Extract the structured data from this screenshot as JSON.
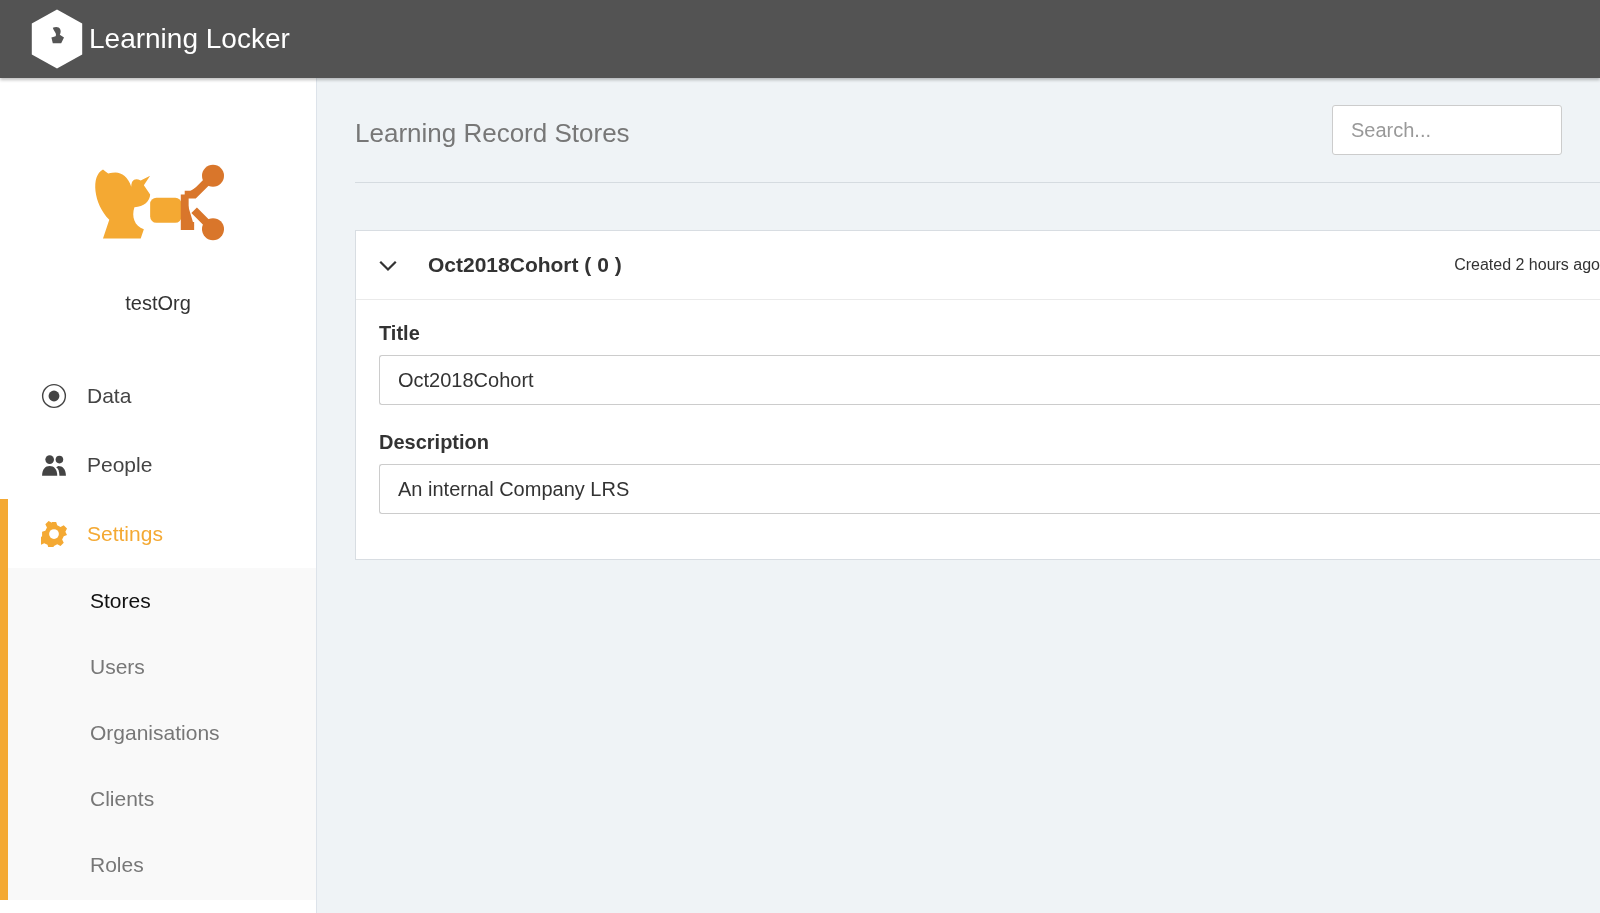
{
  "app": {
    "title": "Learning Locker"
  },
  "sidebar": {
    "org_name": "testOrg",
    "items": [
      {
        "label": "Data",
        "kind": "data",
        "selected": false
      },
      {
        "label": "People",
        "kind": "people",
        "selected": false
      },
      {
        "label": "Settings",
        "kind": "settings",
        "selected": true,
        "expanded": true,
        "children": [
          {
            "label": "Stores",
            "selected": true
          },
          {
            "label": "Users",
            "selected": false
          },
          {
            "label": "Organisations",
            "selected": false
          },
          {
            "label": "Clients",
            "selected": false
          },
          {
            "label": "Roles",
            "selected": false
          }
        ]
      }
    ]
  },
  "page": {
    "title": "Learning Record Stores",
    "search": {
      "placeholder": "Search..."
    }
  },
  "stores": [
    {
      "name": "Oct2018Cohort ( 0 )",
      "created": "Created 2 hours ago",
      "expanded": true,
      "fields": [
        {
          "label": "Title",
          "value": "Oct2018Cohort"
        },
        {
          "label": "Description",
          "value": "An internal Company LRS"
        }
      ]
    }
  ]
}
